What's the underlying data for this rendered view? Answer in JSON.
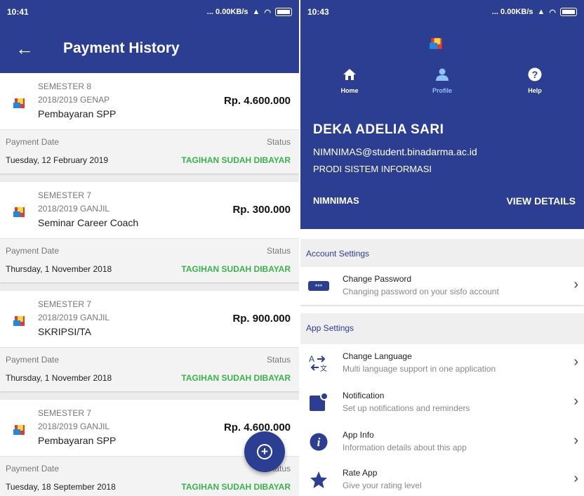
{
  "left": {
    "status_time": "10:41",
    "status_icons": "... 0.00KB/s",
    "title": "Payment History",
    "back_icon": "arrow-left-icon",
    "payment_date_label": "Payment Date",
    "status_label": "Status",
    "payments": [
      {
        "semester": "SEMESTER 8",
        "year": "2018/2019 GENAP",
        "description": "Pembayaran SPP",
        "amount": "Rp. 4.600.000",
        "date": "Tuesday, 12 February 2019",
        "status": "TAGIHAN SUDAH DIBAYAR"
      },
      {
        "semester": "SEMESTER 7",
        "year": "2018/2019 GANJIL",
        "description": "Seminar Career Coach",
        "amount": "Rp. 300.000",
        "date": "Thursday, 1 November 2018",
        "status": "TAGIHAN SUDAH DIBAYAR"
      },
      {
        "semester": "SEMESTER 7",
        "year": "2018/2019 GANJIL",
        "description": "SKRIPSI/TA",
        "amount": "Rp. 900.000",
        "date": "Thursday, 1 November 2018",
        "status": "TAGIHAN SUDAH DIBAYAR"
      },
      {
        "semester": "SEMESTER 7",
        "year": "2018/2019 GANJIL",
        "description": "Pembayaran SPP",
        "amount": "Rp. 4.600.000",
        "date": "Tuesday, 18 September 2018",
        "status": "TAGIHAN SUDAH DIBAYAR"
      }
    ],
    "fab_symbol": "+"
  },
  "right": {
    "status_time": "10:43",
    "status_icons": "... 0.00KB/s",
    "nav": {
      "home": "Home",
      "profile": "Profile",
      "help": "Help"
    },
    "name": "DEKA ADELIA SARI",
    "nim_email": "NIMNIMAS@student.binadarma.ac.id",
    "prodi": "PRODI SISTEM INFORMASI",
    "nim": "NIMNIMAS",
    "view_details": "VIEW DETAILS",
    "account_settings": "Account Settings",
    "change_password": {
      "title": "Change Password",
      "subtitle": "Changing password on your sisfo account"
    },
    "app_settings": "App Settings",
    "change_language": {
      "title": "Change Language",
      "subtitle": "Multi language support in one application"
    },
    "notification": {
      "title": "Notification",
      "subtitle": "Set up notifications and reminders"
    },
    "app_info": {
      "title": "App Info",
      "subtitle": "Information details about this app"
    },
    "rate_app": {
      "title": "Rate App",
      "subtitle": "Give your rating level"
    }
  },
  "colors": {
    "primary": "#2b3e92",
    "paid_green": "#39b44a",
    "active_nav": "#8fc3ff"
  }
}
